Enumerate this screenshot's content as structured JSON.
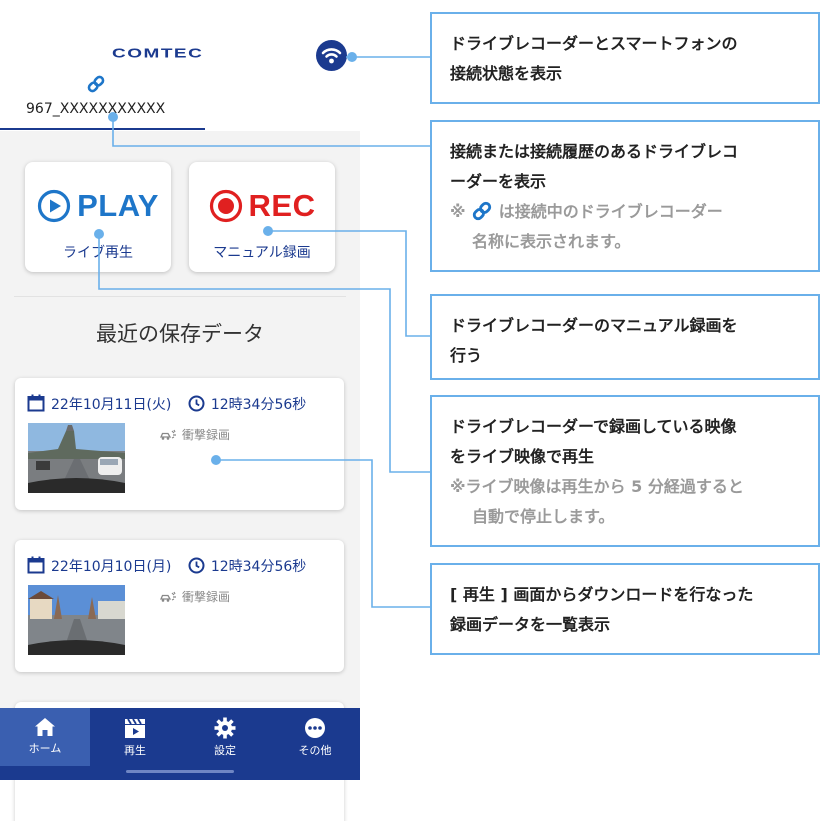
{
  "app": {
    "logo_text": "COMTEC",
    "device_name": "967_XXXXXXXXXXX"
  },
  "buttons": {
    "play": {
      "title": "PLAY",
      "label": "ライブ再生"
    },
    "rec": {
      "title": "REC",
      "label": "マニュアル録画"
    }
  },
  "section": {
    "title": "最近の保存データ"
  },
  "recordings": [
    {
      "date": "22年10月11日(火)",
      "time": "12時34分56秒",
      "tag": "衝撃録画"
    },
    {
      "date": "22年10月10日(月)",
      "time": "12時34分56秒",
      "tag": "衝撃録画"
    }
  ],
  "nav": {
    "items": [
      {
        "label": "ホーム",
        "icon": "home-icon",
        "active": true
      },
      {
        "label": "再生",
        "icon": "clapperboard-icon",
        "active": false
      },
      {
        "label": "設定",
        "icon": "gear-icon",
        "active": false
      },
      {
        "label": "その他",
        "icon": "more-dots-icon",
        "active": false
      }
    ]
  },
  "annotations": {
    "a1": {
      "line1": "ドライブレコーダーとスマートフォンの",
      "line2": "接続状態を表示"
    },
    "a2": {
      "line1": "接続または接続履歴のあるドライブレコ",
      "line2": "ーダーを表示",
      "note_prefix": "※",
      "note_line1": "は接続中のドライブレコーダー",
      "note_line2": "名称に表示されます。"
    },
    "a3": {
      "line1": "ドライブレコーダーのマニュアル録画を",
      "line2": "行う"
    },
    "a4": {
      "line1": "ドライブレコーダーで録画している映像",
      "line2": "をライブ映像で再生",
      "note_line1": "※ライブ映像は再生から 5 分経過すると",
      "note_line2": "自動で停止します。"
    },
    "a5": {
      "line1": "[ 再生 ] 画面からダウンロードを行なった",
      "line2": "録画データを一覧表示"
    }
  },
  "colors": {
    "brand_blue": "#1b3a8f",
    "play_blue": "#1e76c9",
    "rec_red": "#e02020",
    "annotation_border": "#6ab0ea",
    "note_gray": "#9a9a9a"
  }
}
